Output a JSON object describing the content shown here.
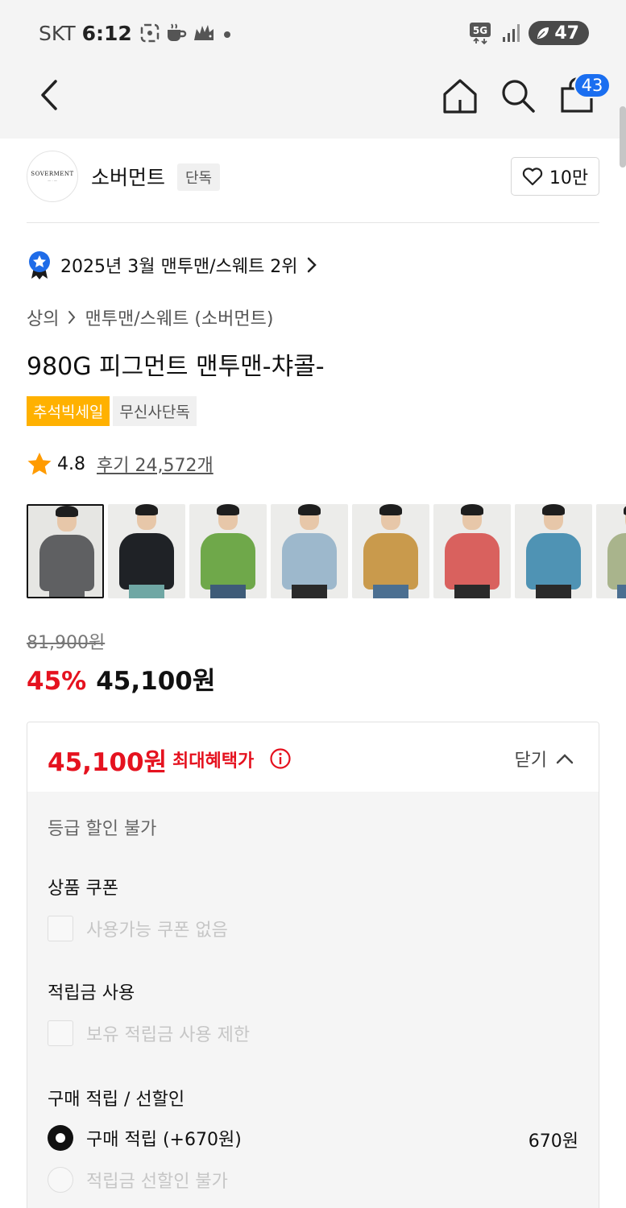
{
  "status_bar": {
    "carrier": "SKT",
    "time": "6:12",
    "network": "5G",
    "battery": "47"
  },
  "nav": {
    "cart_count": "43"
  },
  "brand": {
    "logo_text": "SOVERMENT",
    "name": "소버먼트",
    "tag": "단독",
    "likes": "10만"
  },
  "ranking": {
    "text": "2025년 3월 맨투맨/스웨트 2위"
  },
  "breadcrumb": {
    "category": "상의",
    "subcategory": "맨투맨/스웨트 (소버먼트)"
  },
  "product": {
    "title": "980G 피그먼트 맨투맨-챠콜-",
    "tags": [
      "추석빅세일",
      "무신사단독"
    ],
    "rating": "4.8",
    "reviews": "후기 24,572개",
    "thumbnails": [
      {
        "color": "charcoal",
        "body": "#5f6062",
        "pants": "#5f6062",
        "bg": "#e6e6e3"
      },
      {
        "color": "black",
        "body": "#1f2226",
        "pants": "#6fa7a4",
        "bg": "#ececea"
      },
      {
        "color": "green",
        "body": "#6fa84a",
        "pants": "#3e5b78",
        "bg": "#ececea"
      },
      {
        "color": "sky blue",
        "body": "#9db8cc",
        "pants": "#2a2a2a",
        "bg": "#ececea"
      },
      {
        "color": "mustard",
        "body": "#c99a4c",
        "pants": "#4b6f91",
        "bg": "#ececea"
      },
      {
        "color": "coral",
        "body": "#d9615e",
        "pants": "#2a2a2a",
        "bg": "#ececea"
      },
      {
        "color": "teal blue",
        "body": "#4f93b4",
        "pants": "#2a2a2a",
        "bg": "#ececea"
      },
      {
        "color": "sage",
        "body": "#a9b48c",
        "pants": "#4b6f91",
        "bg": "#ececea"
      }
    ]
  },
  "price": {
    "original": "81,900원",
    "discount": "45%",
    "current": "45,100원"
  },
  "benefit": {
    "max_price": "45,100원",
    "max_label": "최대혜택가",
    "close_label": "닫기",
    "grade_note": "등급 할인 불가",
    "coupon_title": "상품 쿠폰",
    "coupon_option": "사용가능 쿠폰 없음",
    "points_title": "적립금 사용",
    "points_option": "보유 적립금 사용 제한",
    "purchase_title": "구매 적립 / 선할인",
    "purchase_option": "구매 적립 (+670원)",
    "purchase_amount": "670원",
    "prediscount_option": "적립금 선할인 불가"
  },
  "colors": {
    "accent_red": "#e5121f",
    "badge_blue": "#1a6ef0",
    "tag_orange": "#ffb100",
    "star": "#ff9b00",
    "rank_badge": "#1f6ce8"
  }
}
